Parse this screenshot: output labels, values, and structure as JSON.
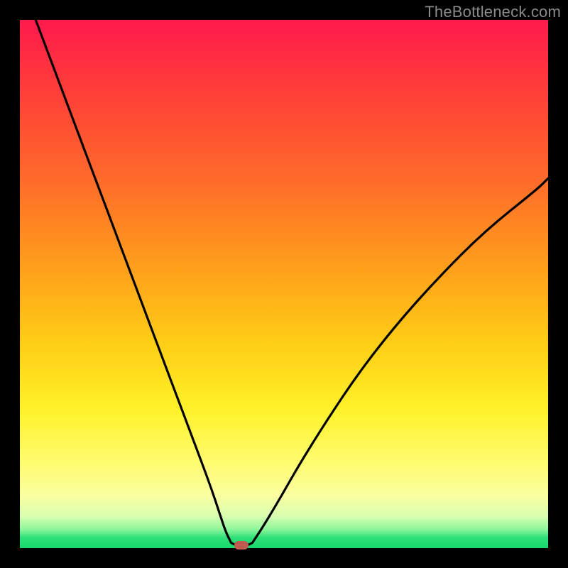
{
  "watermark": "TheBottleneck.com",
  "colors": {
    "frame": "#000000",
    "gradient_top": "#ff1a4d",
    "gradient_mid": "#ffd016",
    "gradient_bottom": "#18d86a",
    "curve": "#000000",
    "marker": "#c25a50"
  },
  "chart_data": {
    "type": "line",
    "title": "",
    "xlabel": "",
    "ylabel": "",
    "xlim": [
      0,
      100
    ],
    "ylim": [
      0,
      100
    ],
    "series": [
      {
        "name": "left-branch",
        "x": [
          3,
          6,
          9,
          12,
          15,
          18,
          21,
          24,
          27,
          30,
          33,
          36,
          38,
          39,
          40
        ],
        "y": [
          100,
          92,
          84,
          76,
          68,
          60,
          52,
          44,
          36,
          28,
          20,
          12,
          6,
          3,
          1
        ]
      },
      {
        "name": "floor",
        "x": [
          40,
          41,
          42,
          43,
          44
        ],
        "y": [
          1,
          0.5,
          0.5,
          0.5,
          1
        ]
      },
      {
        "name": "right-branch",
        "x": [
          44,
          46,
          49,
          53,
          58,
          64,
          71,
          79,
          88,
          98,
          100
        ],
        "y": [
          1,
          4,
          9,
          16,
          24,
          33,
          42,
          51,
          60,
          68,
          70
        ]
      }
    ],
    "marker": {
      "x": 42,
      "y": 0.5
    },
    "grid": false,
    "legend": false
  }
}
